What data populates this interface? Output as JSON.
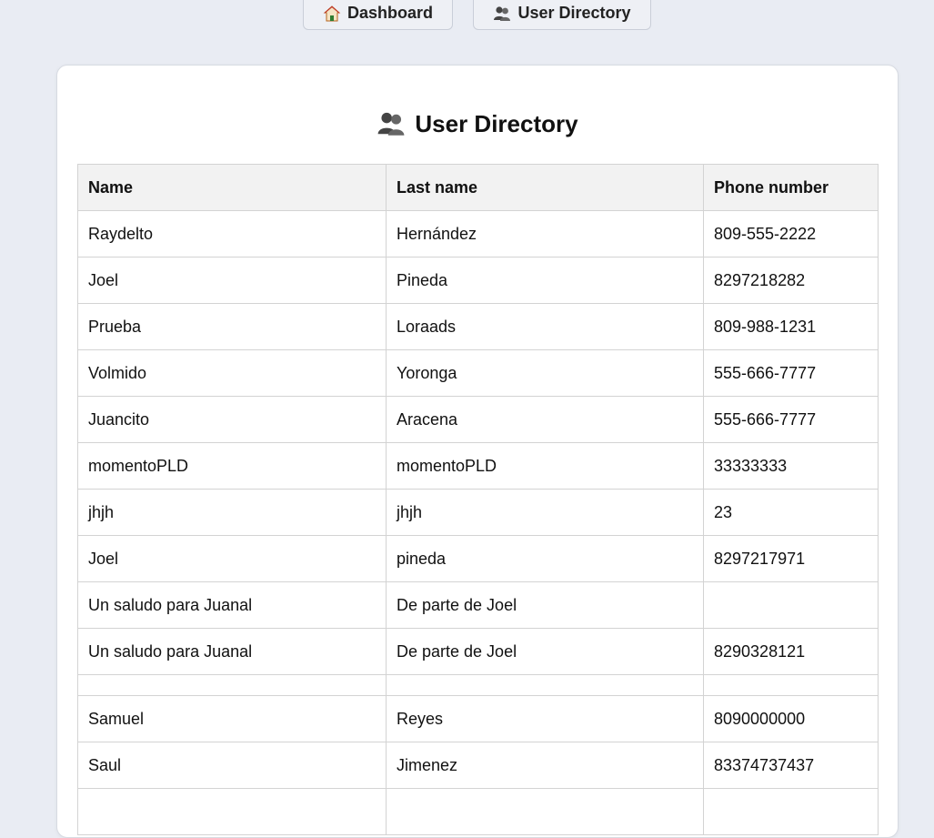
{
  "nav": {
    "dashboard_label": "Dashboard",
    "dashboard_icon": "house-icon",
    "users_label": "User Directory",
    "users_icon": "users-icon"
  },
  "page": {
    "title": "User Directory",
    "title_icon": "users-icon"
  },
  "table": {
    "headers": [
      "Name",
      "Last name",
      "Phone number"
    ],
    "rows": [
      [
        "Raydelto",
        "Hernández",
        "809-555-2222"
      ],
      [
        "Joel",
        "Pineda",
        "8297218282"
      ],
      [
        "Prueba",
        "Loraads",
        "809-988-1231"
      ],
      [
        "Volmido",
        "Yoronga",
        "555-666-7777"
      ],
      [
        "Juancito",
        "Aracena",
        "555-666-7777"
      ],
      [
        "momentoPLD",
        "momentoPLD",
        "33333333"
      ],
      [
        "jhjh",
        "jhjh",
        "23"
      ],
      [
        "Joel",
        "pineda",
        "8297217971"
      ],
      [
        "Un saludo para Juanal",
        "De parte de Joel",
        ""
      ],
      [
        "Un saludo para Juanal",
        "De parte de Joel",
        "8290328121"
      ],
      [
        "",
        "",
        ""
      ],
      [
        "Samuel",
        "Reyes",
        "8090000000"
      ],
      [
        "Saul",
        "Jimenez",
        "83374737437"
      ],
      [
        "",
        "",
        ""
      ]
    ]
  },
  "colors": {
    "background": "#e9ecf3",
    "card": "#ffffff",
    "header_bg": "#f2f2f2",
    "border": "#d3d3d3"
  }
}
